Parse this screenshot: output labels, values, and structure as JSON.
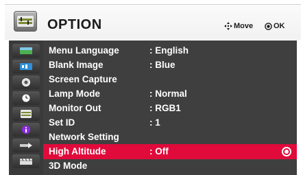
{
  "header": {
    "title": "OPTION",
    "hint_move": "Move",
    "hint_ok": "OK"
  },
  "sidebar": {
    "icons": [
      "picture-icon",
      "audio-icon",
      "time-icon",
      "clock-icon",
      "option-icon",
      "info-icon",
      "input-icon",
      "3d-icon"
    ]
  },
  "menu": {
    "items": [
      {
        "label": "Menu Language",
        "value": ": English"
      },
      {
        "label": "Blank Image",
        "value": ": Blue"
      },
      {
        "label": "Screen Capture",
        "value": ""
      },
      {
        "label": "Lamp Mode",
        "value": ": Normal"
      },
      {
        "label": "Monitor Out",
        "value": ": RGB1"
      },
      {
        "label": "Set ID",
        "value": ": 1"
      },
      {
        "label": "Network Setting",
        "value": ""
      },
      {
        "label": "High Altitude",
        "value": ": Off",
        "selected": true
      },
      {
        "label": "3D Mode",
        "value": ""
      }
    ]
  },
  "colors": {
    "selected": "#e00b3b",
    "panel": "#3f3f3f",
    "sidebar": "#3a3a3a"
  }
}
